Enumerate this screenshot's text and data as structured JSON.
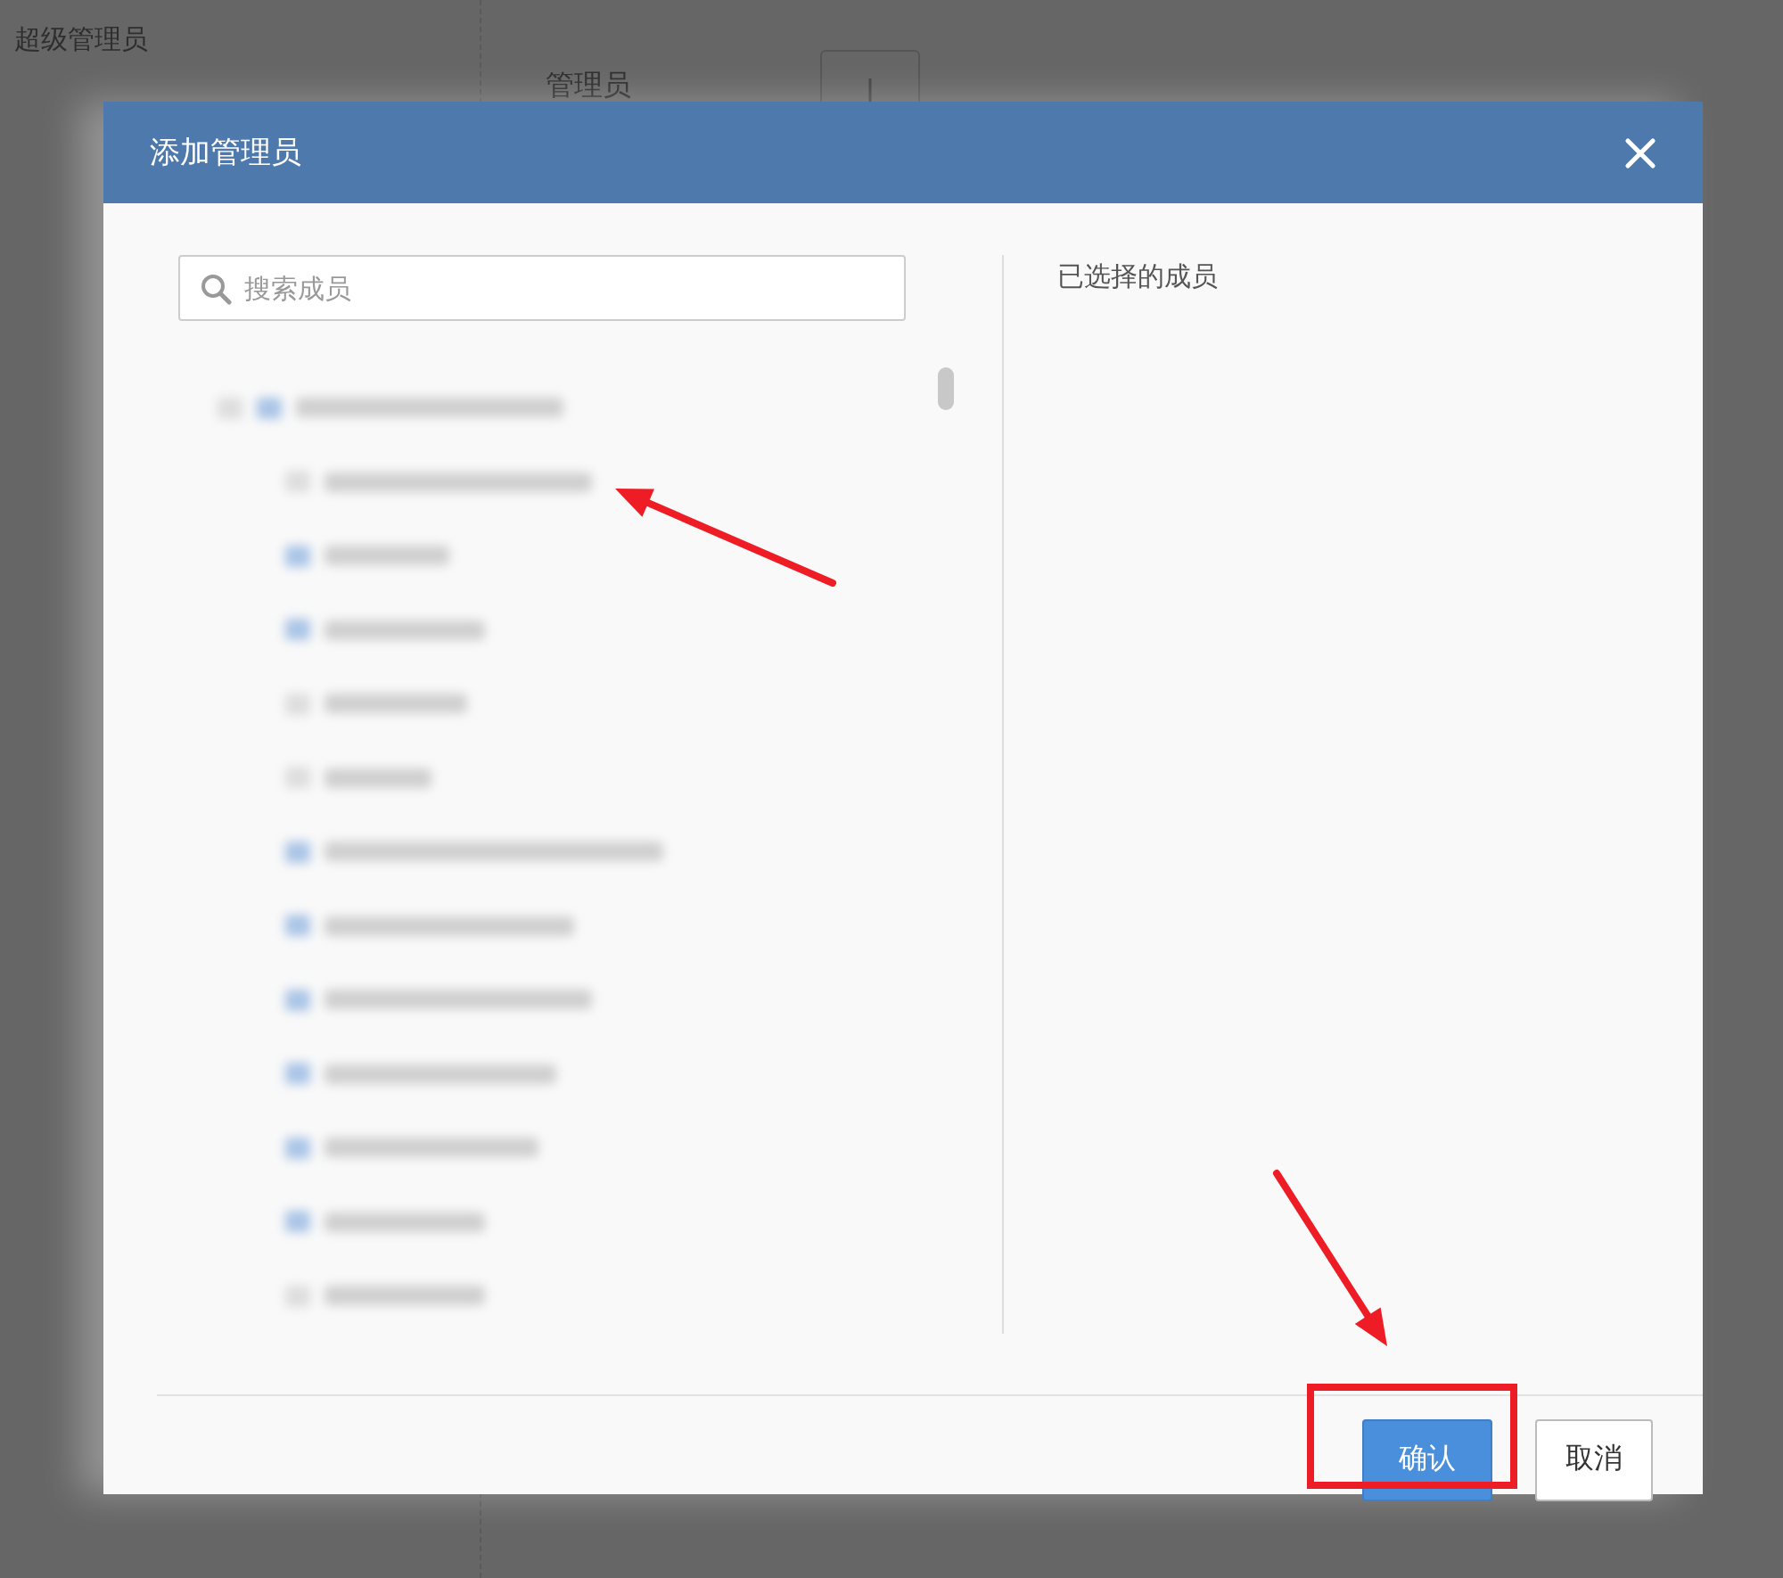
{
  "background": {
    "sidebar_title": "超级管理员",
    "field_label": "管理员"
  },
  "dialog": {
    "title": "添加管理员",
    "search": {
      "placeholder": "搜索成员"
    },
    "tree": [
      {
        "kind": "root"
      },
      {
        "kind": "plain"
      },
      {
        "kind": "folder"
      },
      {
        "kind": "folder"
      },
      {
        "kind": "plain"
      },
      {
        "kind": "plain"
      },
      {
        "kind": "folder"
      },
      {
        "kind": "folder"
      },
      {
        "kind": "folder"
      },
      {
        "kind": "folder"
      },
      {
        "kind": "folder"
      },
      {
        "kind": "folder"
      },
      {
        "kind": "plain"
      }
    ],
    "selected_panel": {
      "title": "已选择的成员"
    },
    "buttons": [
      {
        "label": "确认",
        "kind": "primary"
      },
      {
        "label": "取消",
        "kind": "secondary"
      }
    ]
  },
  "annotations": [
    {
      "kind": "arrow"
    },
    {
      "kind": "arrow"
    },
    {
      "kind": "highlight-box"
    }
  ]
}
